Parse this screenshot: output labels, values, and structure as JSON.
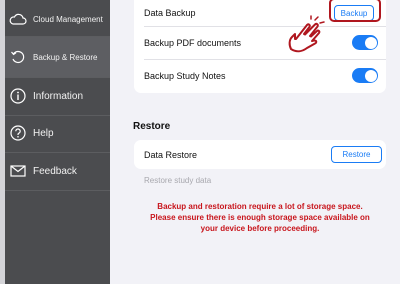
{
  "sidebar": {
    "items": [
      {
        "label": "Cloud Management",
        "icon": "cloud-icon"
      },
      {
        "label": "Backup & Restore",
        "icon": "restore-icon"
      },
      {
        "label": "Information",
        "icon": "info-icon"
      },
      {
        "label": "Help",
        "icon": "help-icon"
      },
      {
        "label": "Feedback",
        "icon": "mail-icon"
      }
    ]
  },
  "backup": {
    "data_backup_label": "Data Backup",
    "backup_button": "Backup",
    "pdf_label": "Backup PDF documents",
    "pdf_enabled": true,
    "notes_label": "Backup Study Notes",
    "notes_enabled": true
  },
  "restore": {
    "section_title": "Restore",
    "data_restore_label": "Data Restore",
    "restore_button": "Restore",
    "hint": "Restore study data"
  },
  "warning": {
    "line1": "Backup and restoration require a lot of storage space.",
    "line2": "Please ensure there is enough storage space available on",
    "line3": "your device before proceeding."
  },
  "colors": {
    "accent": "#1a7cf5",
    "warning": "#c8151c",
    "highlight": "#b0171f",
    "sidebar": "#4b4c4f"
  }
}
